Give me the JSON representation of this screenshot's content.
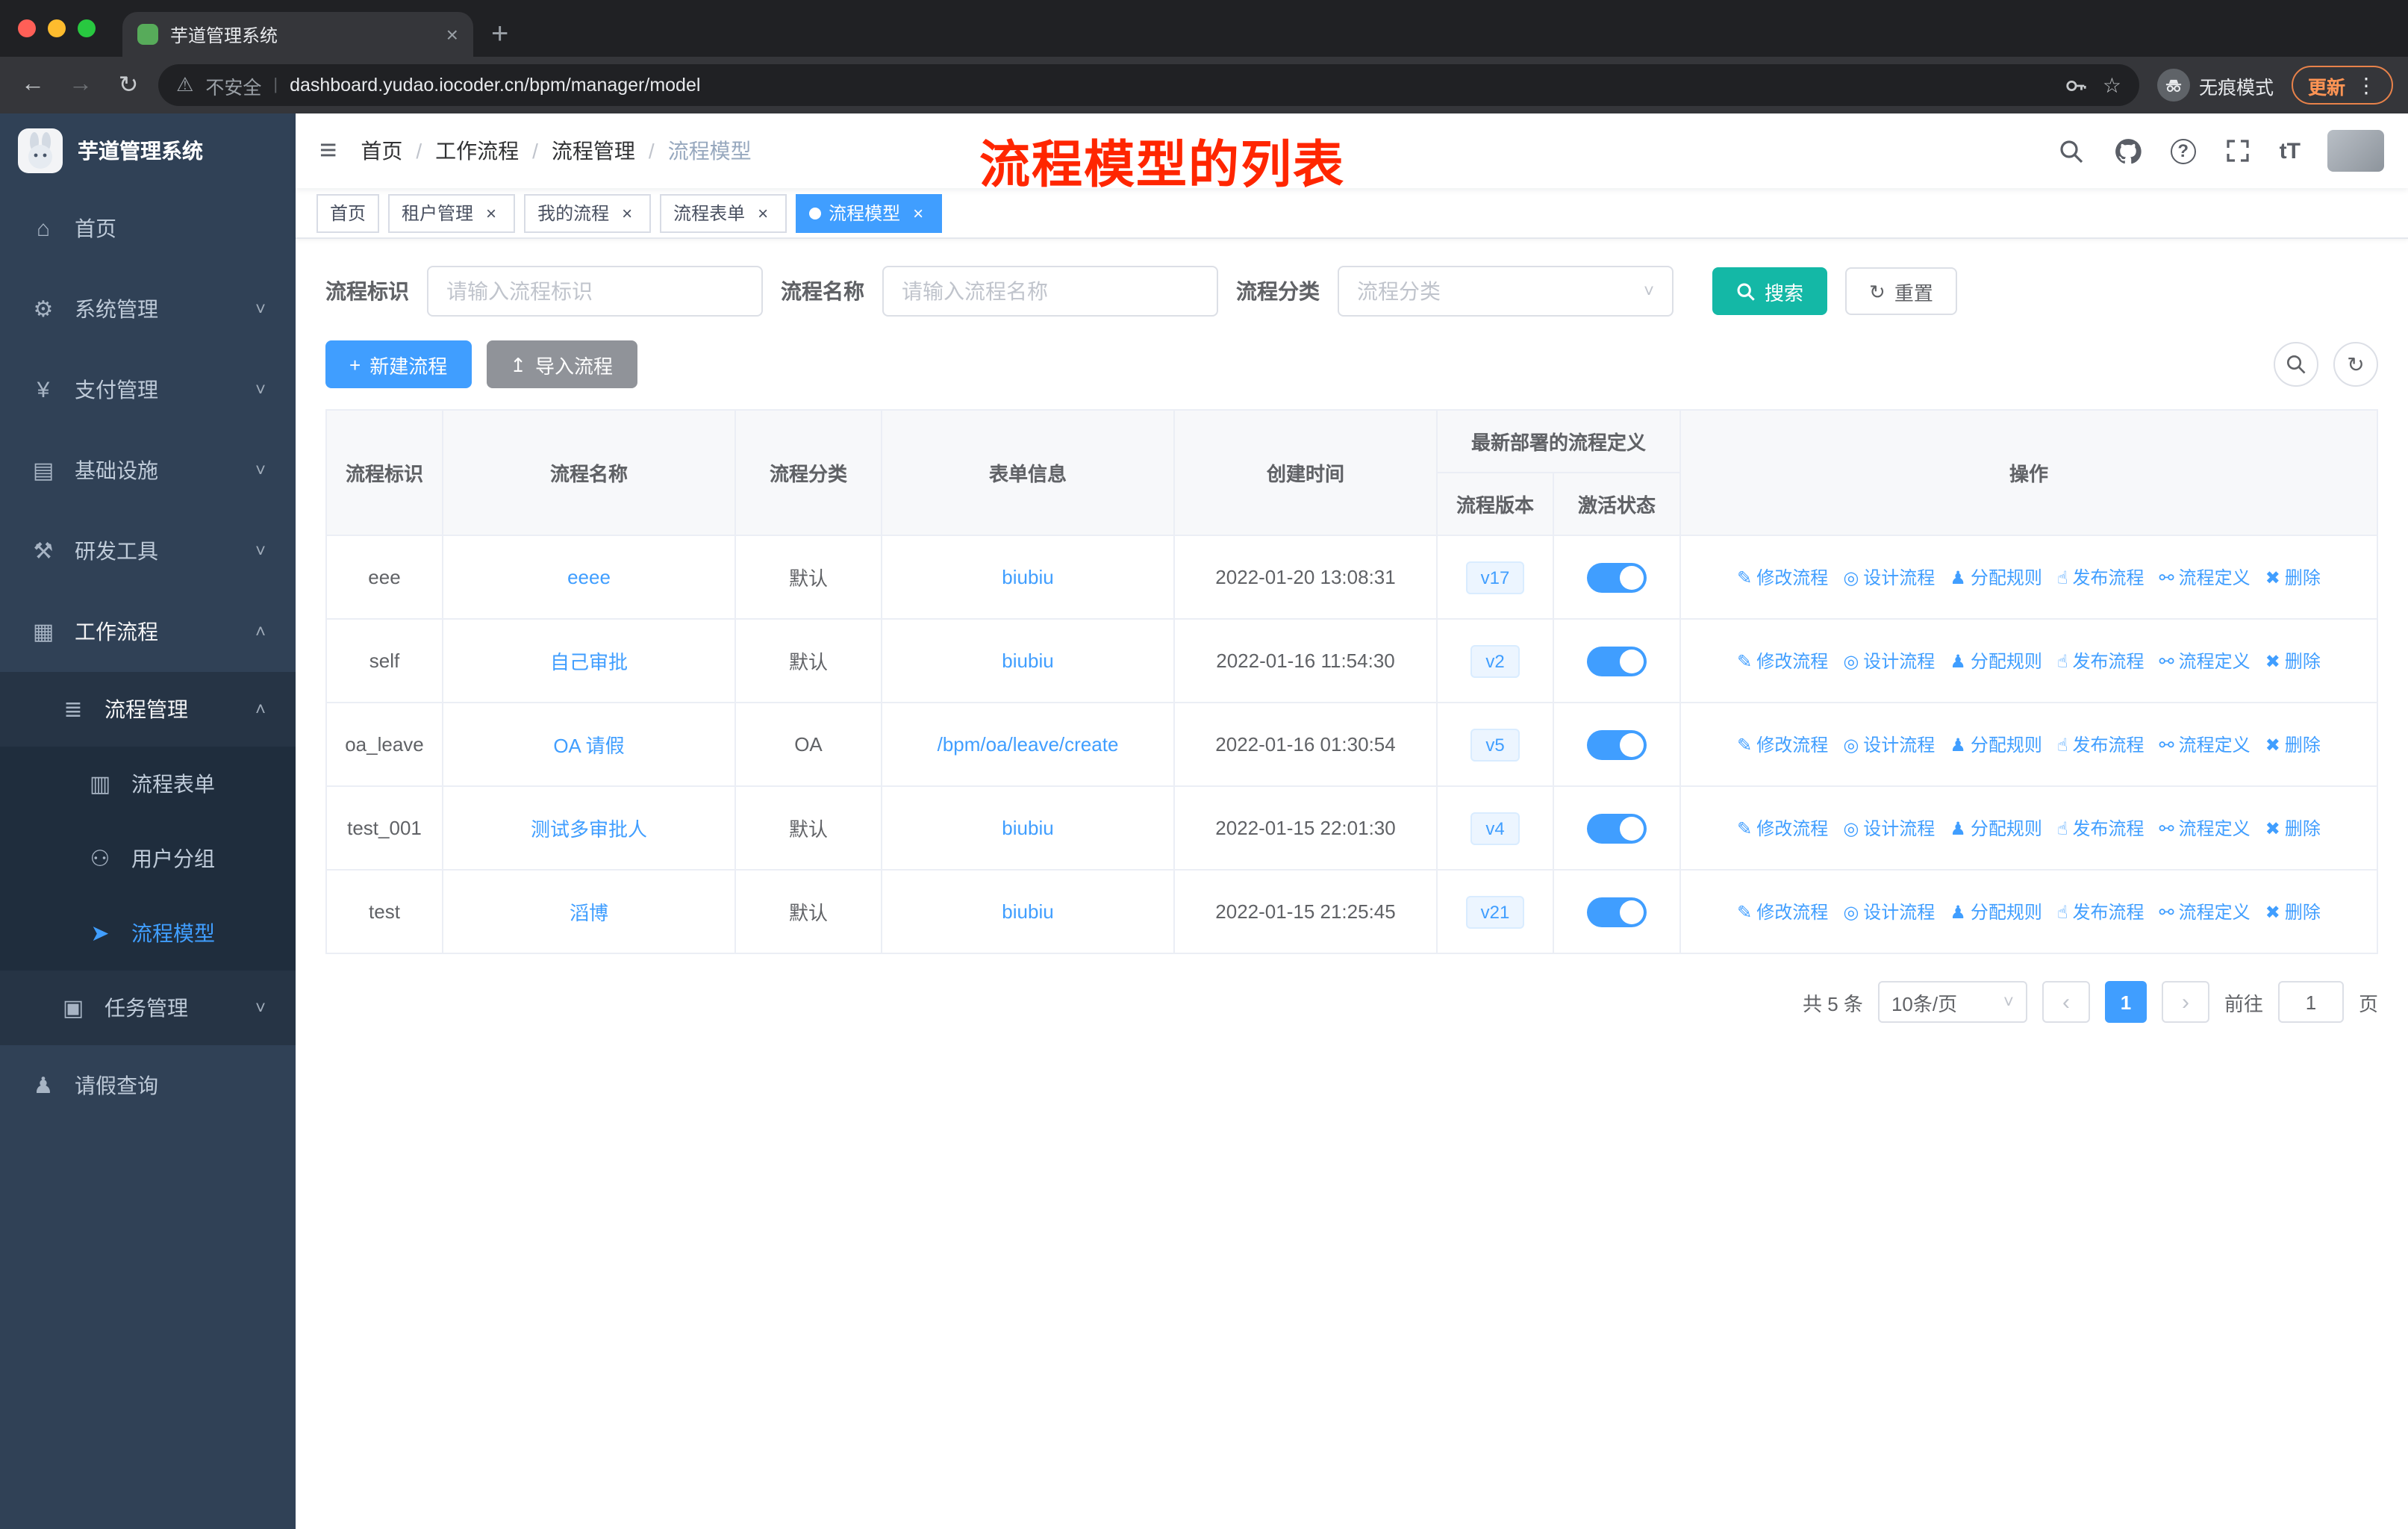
{
  "colors": {
    "accent": "#409eff",
    "search_button_teal": "#14b8a6",
    "annotation_red": "#ff2600",
    "sidebar_bg": "#304156",
    "import_button_gray": "#909399"
  },
  "browser": {
    "tab_title": "芋道管理系统",
    "security_label": "不安全",
    "url": "dashboard.yudao.iocoder.cn/bpm/manager/model",
    "incognito_label": "无痕模式",
    "update_label": "更新"
  },
  "sidebar": {
    "logo_title": "芋道管理系统",
    "menu": [
      {
        "label": "首页",
        "icon": "dashboard-icon",
        "glyph": "⌂",
        "level": 1
      },
      {
        "label": "系统管理",
        "icon": "gear-icon",
        "glyph": "⚙",
        "level": 1,
        "chevron": "down"
      },
      {
        "label": "支付管理",
        "icon": "yen-icon",
        "glyph": "¥",
        "level": 1,
        "chevron": "down"
      },
      {
        "label": "基础设施",
        "icon": "infrastructure-icon",
        "glyph": "▤",
        "level": 1,
        "chevron": "down"
      },
      {
        "label": "研发工具",
        "icon": "tools-icon",
        "glyph": "⚒",
        "level": 1,
        "chevron": "down"
      },
      {
        "label": "工作流程",
        "icon": "briefcase-icon",
        "glyph": "▦",
        "level": 1,
        "chevron": "up",
        "expanded": true
      },
      {
        "label": "流程管理",
        "icon": "list-icon",
        "glyph": "≣",
        "level": 2,
        "chevron": "up",
        "expanded": true
      },
      {
        "label": "流程表单",
        "icon": "form-icon",
        "glyph": "▥",
        "level": 3
      },
      {
        "label": "用户分组",
        "icon": "user-group-icon",
        "glyph": "⚇",
        "level": 3
      },
      {
        "label": "流程模型",
        "icon": "paper-plane-icon",
        "glyph": "➤",
        "level": 3,
        "active": true
      },
      {
        "label": "任务管理",
        "icon": "task-icon",
        "glyph": "▣",
        "level": 2,
        "chevron": "down"
      },
      {
        "label": "请假查询",
        "icon": "user-icon",
        "glyph": "♟",
        "level": 1
      }
    ]
  },
  "navbar": {
    "breadcrumb": [
      "首页",
      "工作流程",
      "流程管理",
      "流程模型"
    ],
    "annotation": "流程模型的列表"
  },
  "tags_view": [
    {
      "label": "首页",
      "closable": false,
      "active": false
    },
    {
      "label": "租户管理",
      "closable": true,
      "active": false
    },
    {
      "label": "我的流程",
      "closable": true,
      "active": false
    },
    {
      "label": "流程表单",
      "closable": true,
      "active": false
    },
    {
      "label": "流程模型",
      "closable": true,
      "active": true
    }
  ],
  "filters": {
    "id_label": "流程标识",
    "id_placeholder": "请输入流程标识",
    "name_label": "流程名称",
    "name_placeholder": "请输入流程名称",
    "category_label": "流程分类",
    "category_placeholder": "流程分类",
    "search_label": "搜索",
    "reset_label": "重置"
  },
  "toolbar": {
    "create_label": "新建流程",
    "import_label": "导入流程"
  },
  "table": {
    "headers": [
      "流程标识",
      "流程名称",
      "流程分类",
      "表单信息",
      "创建时间"
    ],
    "group_header": "最新部署的流程定义",
    "sub_headers": [
      "流程版本",
      "激活状态"
    ],
    "op_header": "操作",
    "actions": [
      {
        "label": "修改流程",
        "icon": "edit-icon",
        "glyph": "✎"
      },
      {
        "label": "设计流程",
        "icon": "design-icon",
        "glyph": "◎"
      },
      {
        "label": "分配规则",
        "icon": "assign-rule-icon",
        "glyph": "♟"
      },
      {
        "label": "发布流程",
        "icon": "publish-icon",
        "glyph": "☝"
      },
      {
        "label": "流程定义",
        "icon": "definition-icon",
        "glyph": "⚯"
      },
      {
        "label": "删除",
        "icon": "delete-icon",
        "glyph": "✖"
      }
    ],
    "rows": [
      {
        "id": "eee",
        "name": "eeee",
        "category": "默认",
        "form": "biubiu",
        "created": "2022-01-20 13:08:31",
        "version": "v17",
        "active": true
      },
      {
        "id": "self",
        "name": "自己审批",
        "category": "默认",
        "form": "biubiu",
        "created": "2022-01-16 11:54:30",
        "version": "v2",
        "active": true
      },
      {
        "id": "oa_leave",
        "name": "OA 请假",
        "category": "OA",
        "form": "/bpm/oa/leave/create",
        "created": "2022-01-16 01:30:54",
        "version": "v5",
        "active": true
      },
      {
        "id": "test_001",
        "name": "测试多审批人",
        "category": "默认",
        "form": "biubiu",
        "created": "2022-01-15 22:01:30",
        "version": "v4",
        "active": true
      },
      {
        "id": "test",
        "name": "滔博",
        "category": "默认",
        "form": "biubiu",
        "created": "2022-01-15 21:25:45",
        "version": "v21",
        "active": true
      }
    ]
  },
  "pagination": {
    "total_text": "共 5 条",
    "page_size": "10条/页",
    "current_page": "1",
    "goto_label": "前往",
    "goto_value": "1",
    "page_unit": "页"
  }
}
